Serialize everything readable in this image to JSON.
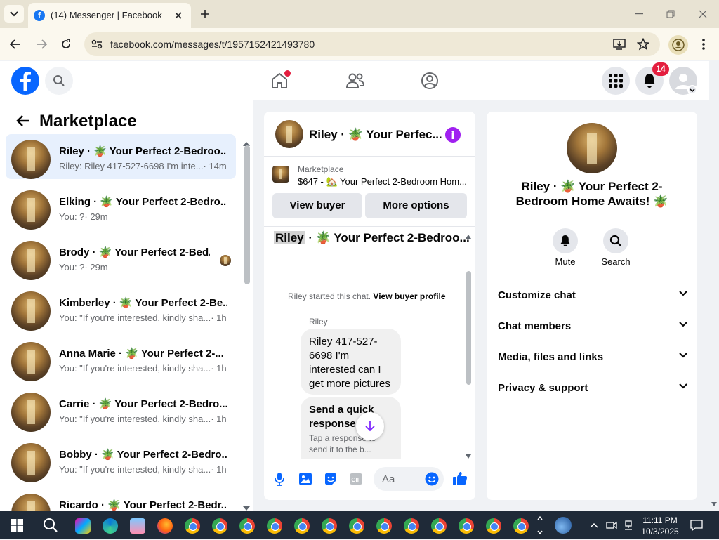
{
  "browser": {
    "tab_title": "(14) Messenger | Facebook",
    "url": "facebook.com/messages/t/1957152421493780"
  },
  "header": {
    "notification_count": "14"
  },
  "marketplace": {
    "title": "Marketplace",
    "conversations": [
      {
        "name": "Riley · 🪴 Your Perfect 2-Bedroo...",
        "preview": "Riley: Riley 417-527-6698 I'm inte...",
        "time": "· 14m"
      },
      {
        "name": "Elking · 🪴 Your Perfect 2-Bedro...",
        "preview": "You: ?",
        "time": "· 29m"
      },
      {
        "name": "Brody · 🪴 Your Perfect 2-Bed...",
        "preview": "You: ?",
        "time": "· 29m"
      },
      {
        "name": "Kimberley · 🪴 Your Perfect 2-Be...",
        "preview": "You: \"If you're interested, kindly sha...",
        "time": "· 1h"
      },
      {
        "name": "Anna Marie · 🪴 Your Perfect 2-...",
        "preview": "You: \"If you're interested, kindly sha...",
        "time": "· 1h"
      },
      {
        "name": "Carrie · 🪴 Your Perfect 2-Bedro...",
        "preview": "You: \"If you're interested, kindly sha...",
        "time": "· 1h"
      },
      {
        "name": "Bobby · 🪴 Your Perfect 2-Bedro...",
        "preview": "You: \"If you're interested, kindly sha...",
        "time": "· 1h"
      },
      {
        "name": "Ricardo · 🪴 Your Perfect 2-Bedr...",
        "preview": "",
        "time": ""
      }
    ]
  },
  "chat": {
    "header_title": "Riley · 🪴 Your Perfec...",
    "listing_label": "Marketplace",
    "listing_text": "$647 - 🏡 Your Perfect 2-Bedroom Hom...",
    "view_buyer": "View buyer",
    "more_options": "More options",
    "thread_name_highlight": "Riley",
    "thread_title_rest": " · 🪴 Your Perfect 2-Bedroo...",
    "started_text": "Riley started this chat.",
    "view_buyer_profile": "View buyer profile",
    "sender": "Riley",
    "message": "Riley 417-527-6698 I'm interested can I get more pictures",
    "quick_title": "Send a quick response",
    "quick_sub": "Tap a response to send it to the b...",
    "composer_placeholder": "Aa"
  },
  "info": {
    "title": "Riley · 🪴 Your Perfect 2-Bedroom Home Awaits! 🪴",
    "mute": "Mute",
    "search": "Search",
    "rows": [
      "Customize chat",
      "Chat members",
      "Media, files and links",
      "Privacy & support"
    ]
  },
  "taskbar": {
    "time": "11:11 PM",
    "date": "10/3/2025"
  }
}
